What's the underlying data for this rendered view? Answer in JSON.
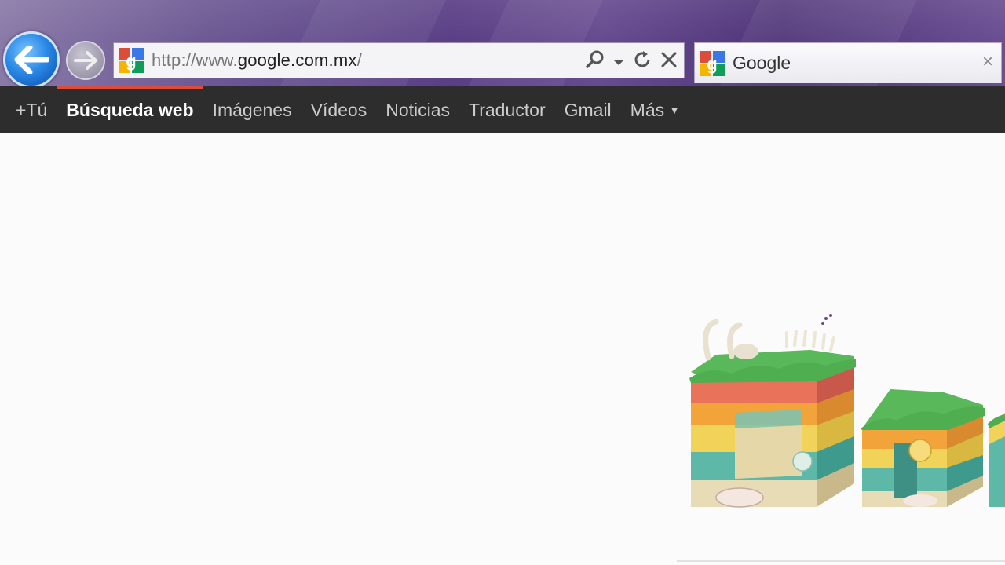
{
  "browser": {
    "address_bar": {
      "url_prefix": "http://www.",
      "url_domain": "google.com.mx",
      "url_suffix": "/",
      "icons": [
        "search-icon",
        "dropdown-icon",
        "refresh-icon",
        "stop-icon"
      ]
    },
    "tab": {
      "title": "Google",
      "close_label": "×"
    },
    "nav": {
      "back_icon": "back-arrow-icon",
      "forward_icon": "forward-arrow-icon"
    }
  },
  "google_bar": {
    "items": [
      {
        "label": "+Tú"
      },
      {
        "label": "Búsqueda web",
        "active": true
      },
      {
        "label": "Imágenes"
      },
      {
        "label": "Vídeos"
      },
      {
        "label": "Noticias"
      },
      {
        "label": "Traductor"
      },
      {
        "label": "Gmail"
      },
      {
        "label": "Más"
      }
    ],
    "active_color": "#dd4b39",
    "background": "#2d2d2d"
  },
  "doodle": {
    "description_icon": "google-doodle-geology-icon"
  }
}
